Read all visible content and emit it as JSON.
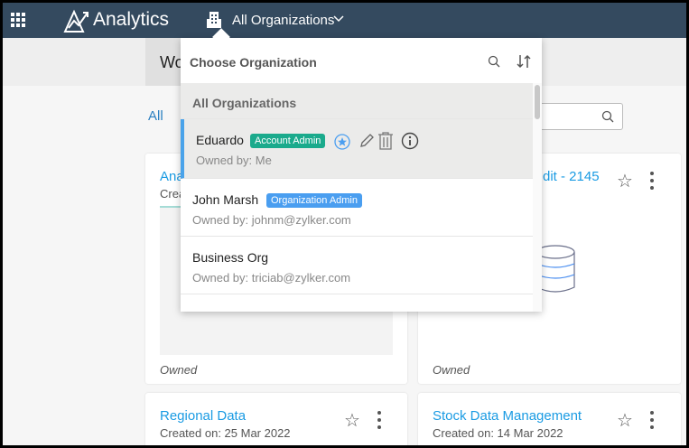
{
  "header": {
    "app_title": "Analytics",
    "org_selector": "All Organizations"
  },
  "workspace_tab": "Wo",
  "filter_all": "All",
  "dropdown": {
    "title": "Choose Organization",
    "all_label": "All Organizations",
    "items": [
      {
        "name": "Eduardo",
        "role": "Account Admin",
        "role_color": "#1aaa8c",
        "owner": "Owned by: Me",
        "selected": true
      },
      {
        "name": "John Marsh",
        "role": "Organization Admin",
        "role_color": "#4a9ef0",
        "owner": "Owned by: johnm@zylker.com"
      },
      {
        "name": "Business Org",
        "owner": "Owned by: triciab@zylker.com"
      }
    ]
  },
  "cards": [
    {
      "title": "Ana",
      "subtitle": "Crea",
      "footer": "Owned"
    },
    {
      "title": "dit - 2145",
      "footer": "Owned"
    },
    {
      "title": "Regional Data",
      "subtitle": "Created on: 25 Mar 2022"
    },
    {
      "title": "Stock Data Management",
      "subtitle": "Created on: 14 Mar 2022"
    }
  ]
}
